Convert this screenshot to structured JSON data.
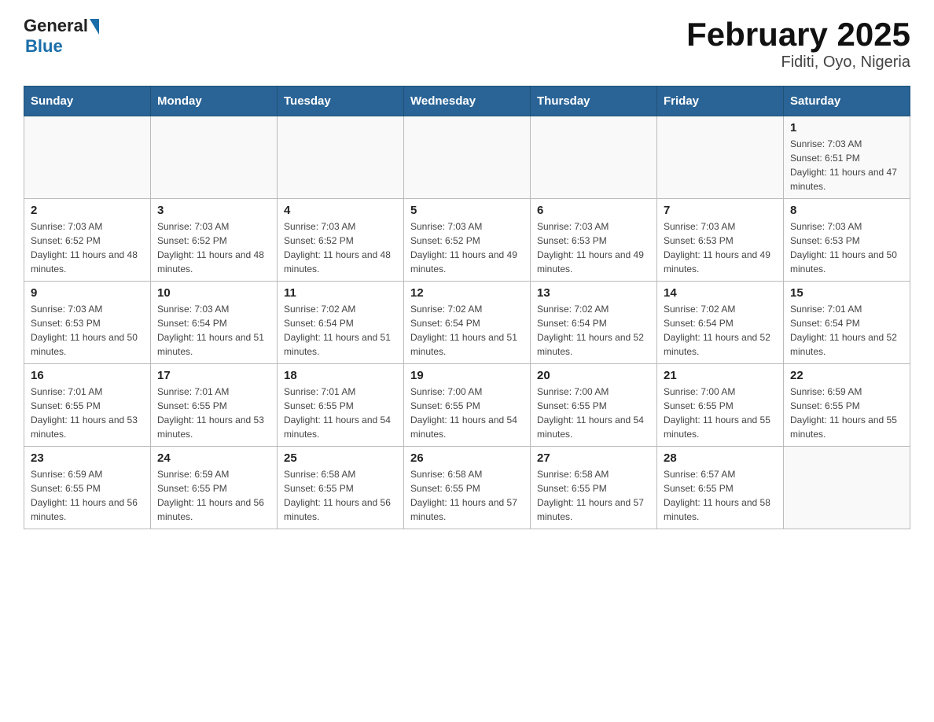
{
  "header": {
    "logo_general": "General",
    "logo_blue": "Blue",
    "title": "February 2025",
    "subtitle": "Fiditi, Oyo, Nigeria"
  },
  "days_of_week": [
    "Sunday",
    "Monday",
    "Tuesday",
    "Wednesday",
    "Thursday",
    "Friday",
    "Saturday"
  ],
  "weeks": [
    {
      "days": [
        {
          "num": "",
          "info": ""
        },
        {
          "num": "",
          "info": ""
        },
        {
          "num": "",
          "info": ""
        },
        {
          "num": "",
          "info": ""
        },
        {
          "num": "",
          "info": ""
        },
        {
          "num": "",
          "info": ""
        },
        {
          "num": "1",
          "info": "Sunrise: 7:03 AM\nSunset: 6:51 PM\nDaylight: 11 hours and 47 minutes."
        }
      ]
    },
    {
      "days": [
        {
          "num": "2",
          "info": "Sunrise: 7:03 AM\nSunset: 6:52 PM\nDaylight: 11 hours and 48 minutes."
        },
        {
          "num": "3",
          "info": "Sunrise: 7:03 AM\nSunset: 6:52 PM\nDaylight: 11 hours and 48 minutes."
        },
        {
          "num": "4",
          "info": "Sunrise: 7:03 AM\nSunset: 6:52 PM\nDaylight: 11 hours and 48 minutes."
        },
        {
          "num": "5",
          "info": "Sunrise: 7:03 AM\nSunset: 6:52 PM\nDaylight: 11 hours and 49 minutes."
        },
        {
          "num": "6",
          "info": "Sunrise: 7:03 AM\nSunset: 6:53 PM\nDaylight: 11 hours and 49 minutes."
        },
        {
          "num": "7",
          "info": "Sunrise: 7:03 AM\nSunset: 6:53 PM\nDaylight: 11 hours and 49 minutes."
        },
        {
          "num": "8",
          "info": "Sunrise: 7:03 AM\nSunset: 6:53 PM\nDaylight: 11 hours and 50 minutes."
        }
      ]
    },
    {
      "days": [
        {
          "num": "9",
          "info": "Sunrise: 7:03 AM\nSunset: 6:53 PM\nDaylight: 11 hours and 50 minutes."
        },
        {
          "num": "10",
          "info": "Sunrise: 7:03 AM\nSunset: 6:54 PM\nDaylight: 11 hours and 51 minutes."
        },
        {
          "num": "11",
          "info": "Sunrise: 7:02 AM\nSunset: 6:54 PM\nDaylight: 11 hours and 51 minutes."
        },
        {
          "num": "12",
          "info": "Sunrise: 7:02 AM\nSunset: 6:54 PM\nDaylight: 11 hours and 51 minutes."
        },
        {
          "num": "13",
          "info": "Sunrise: 7:02 AM\nSunset: 6:54 PM\nDaylight: 11 hours and 52 minutes."
        },
        {
          "num": "14",
          "info": "Sunrise: 7:02 AM\nSunset: 6:54 PM\nDaylight: 11 hours and 52 minutes."
        },
        {
          "num": "15",
          "info": "Sunrise: 7:01 AM\nSunset: 6:54 PM\nDaylight: 11 hours and 52 minutes."
        }
      ]
    },
    {
      "days": [
        {
          "num": "16",
          "info": "Sunrise: 7:01 AM\nSunset: 6:55 PM\nDaylight: 11 hours and 53 minutes."
        },
        {
          "num": "17",
          "info": "Sunrise: 7:01 AM\nSunset: 6:55 PM\nDaylight: 11 hours and 53 minutes."
        },
        {
          "num": "18",
          "info": "Sunrise: 7:01 AM\nSunset: 6:55 PM\nDaylight: 11 hours and 54 minutes."
        },
        {
          "num": "19",
          "info": "Sunrise: 7:00 AM\nSunset: 6:55 PM\nDaylight: 11 hours and 54 minutes."
        },
        {
          "num": "20",
          "info": "Sunrise: 7:00 AM\nSunset: 6:55 PM\nDaylight: 11 hours and 54 minutes."
        },
        {
          "num": "21",
          "info": "Sunrise: 7:00 AM\nSunset: 6:55 PM\nDaylight: 11 hours and 55 minutes."
        },
        {
          "num": "22",
          "info": "Sunrise: 6:59 AM\nSunset: 6:55 PM\nDaylight: 11 hours and 55 minutes."
        }
      ]
    },
    {
      "days": [
        {
          "num": "23",
          "info": "Sunrise: 6:59 AM\nSunset: 6:55 PM\nDaylight: 11 hours and 56 minutes."
        },
        {
          "num": "24",
          "info": "Sunrise: 6:59 AM\nSunset: 6:55 PM\nDaylight: 11 hours and 56 minutes."
        },
        {
          "num": "25",
          "info": "Sunrise: 6:58 AM\nSunset: 6:55 PM\nDaylight: 11 hours and 56 minutes."
        },
        {
          "num": "26",
          "info": "Sunrise: 6:58 AM\nSunset: 6:55 PM\nDaylight: 11 hours and 57 minutes."
        },
        {
          "num": "27",
          "info": "Sunrise: 6:58 AM\nSunset: 6:55 PM\nDaylight: 11 hours and 57 minutes."
        },
        {
          "num": "28",
          "info": "Sunrise: 6:57 AM\nSunset: 6:55 PM\nDaylight: 11 hours and 58 minutes."
        },
        {
          "num": "",
          "info": ""
        }
      ]
    }
  ]
}
